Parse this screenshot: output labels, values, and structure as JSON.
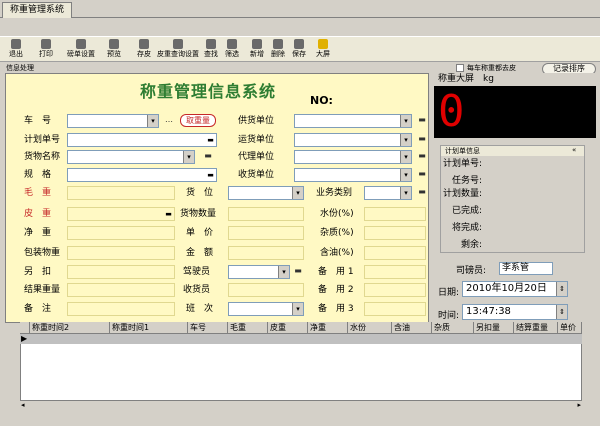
{
  "window_tab": "称重管理系统",
  "toolbar": [
    "退出",
    "打印",
    "磅单设置",
    "预览",
    "存皮",
    "皮重查询设置",
    "查找",
    "筛选",
    "新增",
    "删除",
    "保存",
    "大屏"
  ],
  "info_label": "信息处理",
  "checkbox_label": "每车称重都去皮",
  "record_sort": "记录排序",
  "app_title": "称重管理信息系统",
  "no_label": "NO:",
  "get_weight": "取重量",
  "labels_left": [
    "车　号",
    "计划单号",
    "货物名称",
    "规　格",
    "毛　重",
    "皮　重",
    "净　重",
    "包装物重",
    "另　扣",
    "结果重量",
    "备　注"
  ],
  "labels_mid_top": [
    "供货单位",
    "运货单位",
    "代理单位",
    "收货单位"
  ],
  "labels_mid": [
    "货　位",
    "货物数量",
    "单　价",
    "金　额",
    "驾驶员",
    "收货员",
    "班　次"
  ],
  "labels_right": [
    "业务类别",
    "水份(%)",
    "杂质(%)",
    "含油(%)",
    "备　用 1",
    "备　用 2",
    "备　用 3"
  ],
  "weigh_label": "称重大屏　kg",
  "weigh_value": "0",
  "plan_header": "计划单信息",
  "plan_fields": [
    "计划单号:",
    "任务号:",
    "计划数量:",
    "已完成:",
    "将完成:",
    "剩余:"
  ],
  "operator_label": "司磅员:",
  "operator_value": "李系管",
  "date_label": "日期:",
  "date_value": "2010年10月20日",
  "time_label": "时间:",
  "time_value": "13:47:38",
  "grid_cols": [
    "称重时间2",
    "称重时间1",
    "车号",
    "毛重",
    "皮重",
    "净重",
    "水份",
    "含油",
    "杂质",
    "另扣量",
    "结算重量",
    "单价"
  ]
}
